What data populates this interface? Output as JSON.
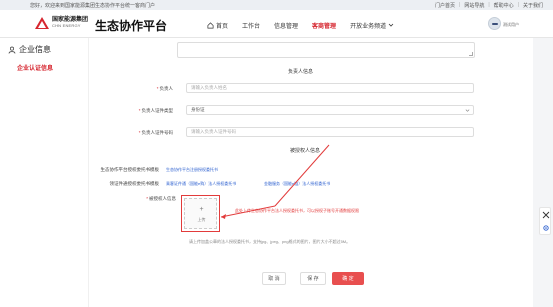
{
  "topbar": {
    "welcome": "您好，欢迎来到国家能源集团生态协作平台统一客商门户",
    "links": [
      "门户首页",
      "网站导航",
      "帮助中心",
      "关于我们"
    ]
  },
  "header": {
    "logo_cn": "国家能源集团",
    "logo_en": "CHN ENERGY",
    "brand_title": "生态协作平台",
    "nav": [
      {
        "label": "首页",
        "icon": "home-icon",
        "active": false
      },
      {
        "label": "工作台",
        "active": false
      },
      {
        "label": "信息管理",
        "active": false
      },
      {
        "label": "客商管理",
        "active": true
      },
      {
        "label": "开放业务频道",
        "icon": "chevron-down-icon",
        "active": false
      }
    ],
    "user_name": "测试用户"
  },
  "sidebar": {
    "title": "企业信息",
    "items": [
      {
        "label": "企业认证信息",
        "active": true
      }
    ]
  },
  "form": {
    "principal_section": "负责人信息",
    "fields": [
      {
        "label": "负责人",
        "required": true,
        "placeholder": "请输入负责人姓名"
      },
      {
        "label": "负责人证件类型",
        "required": true,
        "value": "身份证"
      },
      {
        "label": "负责人证件号码",
        "required": true,
        "placeholder": "请输入负责人证件号码"
      }
    ],
    "auth_section": "被授权人信息",
    "docs": [
      {
        "label": "生态协作平台授权委托书模板",
        "links": [
          "生态协作平台注册授权委托书"
        ]
      },
      {
        "label": "领证件通授权委托书模板",
        "links": [
          "乘客证件通（国能e购）法人授权委托书",
          "金融服务（国能e链）法人授权委托书"
        ]
      }
    ],
    "upload_label": "被授权人信息",
    "upload_button": "上传",
    "annotation": "此处上传生态协作平台法人授权委托书，可以授权子账号开通数据权限",
    "hint": "请上传加盖公章的法人授权委托书，支持jpg、jpeg、png格式的图片，图片大小不超过5M。",
    "buttons": {
      "cancel": "取 消",
      "save": "保 存",
      "confirm": "确 定"
    }
  },
  "colors": {
    "accent": "#d6262f",
    "link": "#2b5fcf",
    "confirm": "#e84f4f"
  }
}
